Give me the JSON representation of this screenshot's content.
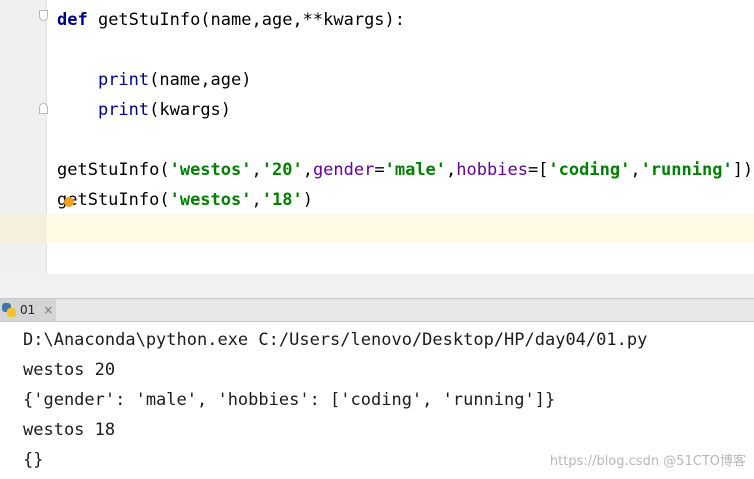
{
  "editor": {
    "lines": [
      {
        "segments": [
          {
            "text": "def",
            "kind": "kw"
          },
          {
            "text": " getStuInfo(",
            "kind": "plain"
          },
          {
            "text": "name,age,**kwargs):",
            "kind": "plain"
          }
        ]
      },
      {
        "segments": []
      },
      {
        "segments": [
          {
            "text": "    ",
            "kind": "plain"
          },
          {
            "text": "print",
            "kind": "builtin"
          },
          {
            "text": "(name,age)",
            "kind": "plain"
          }
        ]
      },
      {
        "segments": [
          {
            "text": "    ",
            "kind": "plain"
          },
          {
            "text": "print",
            "kind": "builtin"
          },
          {
            "text": "(kwargs)",
            "kind": "plain"
          }
        ]
      },
      {
        "segments": []
      },
      {
        "segments": [
          {
            "text": "getStuInfo(",
            "kind": "plain"
          },
          {
            "text": "'westos'",
            "kind": "str"
          },
          {
            "text": ",",
            "kind": "plain"
          },
          {
            "text": "'20'",
            "kind": "str"
          },
          {
            "text": ",",
            "kind": "plain"
          },
          {
            "text": "gender",
            "kind": "param"
          },
          {
            "text": "=",
            "kind": "plain"
          },
          {
            "text": "'male'",
            "kind": "str"
          },
          {
            "text": ",",
            "kind": "plain"
          },
          {
            "text": "hobbies",
            "kind": "param"
          },
          {
            "text": "=[",
            "kind": "plain"
          },
          {
            "text": "'coding'",
            "kind": "str"
          },
          {
            "text": ",",
            "kind": "plain"
          },
          {
            "text": "'running'",
            "kind": "str"
          },
          {
            "text": "])",
            "kind": "plain"
          }
        ]
      },
      {
        "segments": [
          {
            "text": "getStuInfo(",
            "kind": "plain"
          },
          {
            "text": "'westos'",
            "kind": "str"
          },
          {
            "text": ",",
            "kind": "plain"
          },
          {
            "text": "'18'",
            "kind": "str"
          },
          {
            "text": ")",
            "kind": "plain"
          }
        ]
      }
    ]
  },
  "run_panel": {
    "tab_label": "01",
    "tab_close": "×",
    "tab_icon": "python-icon"
  },
  "console": {
    "lines": [
      "D:\\Anaconda\\python.exe C:/Users/lenovo/Desktop/HP/day04/01.py",
      "westos 20",
      "{'gender': 'male', 'hobbies': ['coding', 'running']}",
      "westos 18",
      "{}"
    ]
  },
  "watermark": "https://blog.csdn @51CTO博客",
  "colors": {
    "keyword": "#000080",
    "string": "#008000",
    "param": "#660099",
    "current_line": "#fffae3",
    "intention_bulb": "#f0a020"
  }
}
